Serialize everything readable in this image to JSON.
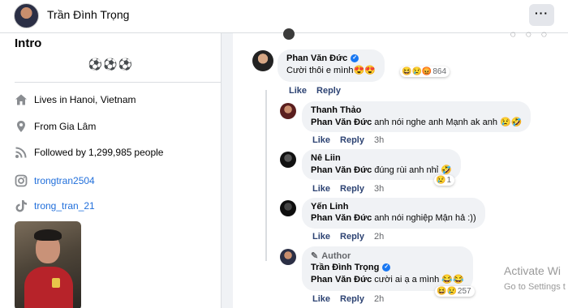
{
  "header": {
    "profile_name": "Trần Đình Trọng",
    "more_label": "···"
  },
  "intro": {
    "title": "Intro",
    "bio": "⚽⚽⚽",
    "lives_prefix": "Lives in",
    "lives_place": "Hanoi, Vietnam",
    "from_prefix": "From",
    "from_place": "Gia Lâm",
    "followed_prefix": "Followed by",
    "followed_count": "1,299,985",
    "followed_suffix": "people",
    "instagram": "trongtran2504",
    "tiktok": "trong_tran_21"
  },
  "comments": [
    {
      "name": "Phan Văn Đức",
      "verified": true,
      "text": "Cười thôi e mình😍😍",
      "reactions": "😆😢😡",
      "reaction_count": "864",
      "like": "Like",
      "reply": "Reply",
      "time": ""
    },
    {
      "name": "Thanh Thảo",
      "mention": "Phan Văn Đức",
      "text": " anh nói nghe anh Mạnh ak anh 😢🤣",
      "like": "Like",
      "reply": "Reply",
      "time": "3h"
    },
    {
      "name": "Nê Liin",
      "mention": "Phan Văn Đức",
      "text": " đúng rùi anh nhỉ 🤣",
      "reactions": "😢",
      "reaction_count": "1",
      "like": "Like",
      "reply": "Reply",
      "time": "3h"
    },
    {
      "name": "Yến Linh",
      "mention": "Phan Văn Đức",
      "text": " anh nói nghiệp Mận hả :))",
      "like": "Like",
      "reply": "Reply",
      "time": "2h"
    },
    {
      "author_tag": "Author",
      "name": "Trần Đình Trọng",
      "verified": true,
      "mention": "Phan Văn Đức",
      "text": " cười ai ạ a mình 😂😂",
      "reactions": "😆😢",
      "reaction_count": "257",
      "like": "Like",
      "reply": "Reply",
      "time": "2h"
    }
  ],
  "watermark": {
    "line1": "Activate Wi",
    "line2": "Go to Settings t"
  }
}
